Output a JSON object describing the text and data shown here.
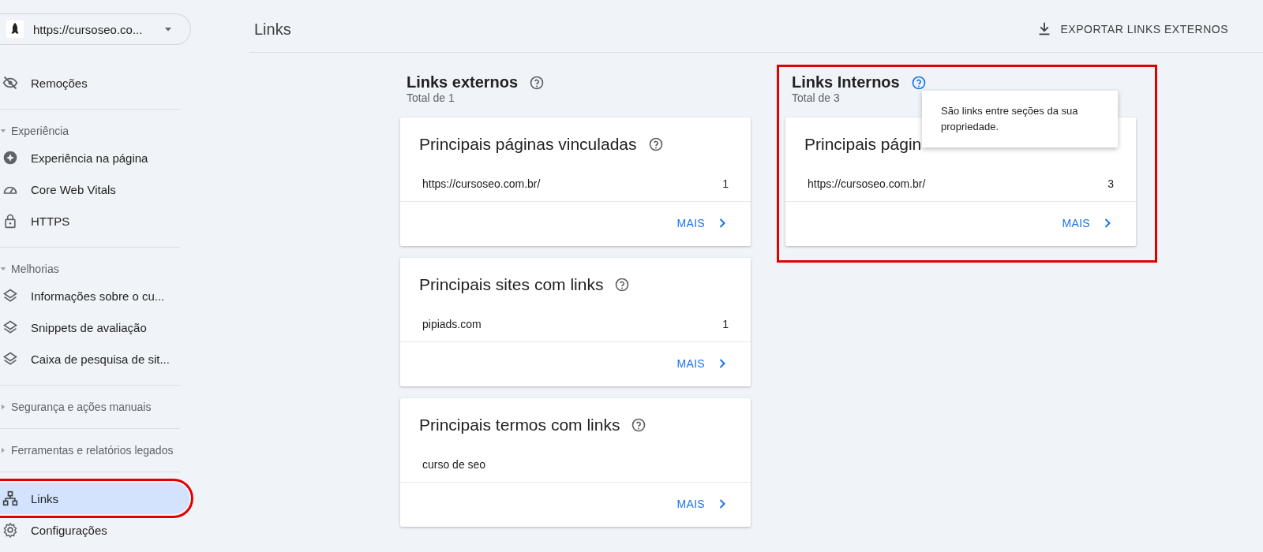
{
  "property_selector": {
    "label": "https://cursoseo.co..."
  },
  "sidebar": {
    "groups": [
      {
        "items": [
          {
            "label": "Remoções",
            "selected": false
          }
        ]
      },
      {
        "title": "Experiência",
        "expanded": true,
        "items": [
          {
            "label": "Experiência na página",
            "selected": false
          },
          {
            "label": "Core Web Vitals",
            "selected": false
          },
          {
            "label": "HTTPS",
            "selected": false
          }
        ]
      },
      {
        "title": "Melhorias",
        "expanded": true,
        "items": [
          {
            "label": "Informações sobre o cu...",
            "selected": false
          },
          {
            "label": "Snippets de avaliação",
            "selected": false
          },
          {
            "label": "Caixa de pesquisa de sit...",
            "selected": false
          }
        ]
      },
      {
        "title": "Segurança e ações manuais",
        "expanded": false
      },
      {
        "title": "Ferramentas e relatórios legados",
        "expanded": false
      },
      {
        "items": [
          {
            "label": "Links",
            "selected": true,
            "highlighted": true
          },
          {
            "label": "Configurações",
            "selected": false
          }
        ]
      }
    ]
  },
  "header": {
    "title": "Links",
    "export_button": "EXPORTAR LINKS EXTERNOS"
  },
  "sections": [
    {
      "title": "Links externos",
      "total": "Total de 1",
      "cards": [
        {
          "title": "Principais páginas vinculadas",
          "help": true,
          "rows": [
            {
              "label": "https://cursoseo.com.br/",
              "value": "1"
            }
          ],
          "more": "MAIS"
        },
        {
          "title": "Principais sites com links",
          "help": true,
          "rows": [
            {
              "label": "pipiads.com",
              "value": "1"
            }
          ],
          "more": "MAIS"
        },
        {
          "title": "Principais termos com links",
          "help": true,
          "rows": [
            {
              "label": "curso de seo"
            }
          ],
          "more": "MAIS"
        }
      ]
    },
    {
      "title": "Links Internos",
      "total": "Total de 3",
      "highlighted": true,
      "tooltip": "São links entre seções da sua propriedade.",
      "cards": [
        {
          "title": "Principais págin",
          "help": false,
          "rows": [
            {
              "label": "https://cursoseo.com.br/",
              "value": "3"
            }
          ],
          "more": "MAIS"
        }
      ]
    }
  ]
}
